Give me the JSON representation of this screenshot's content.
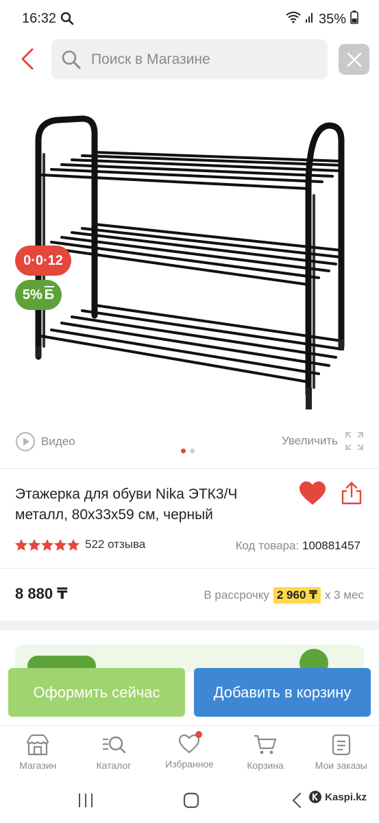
{
  "status": {
    "time": "16:32",
    "battery": "35%"
  },
  "search": {
    "placeholder": "Поиск в Магазине"
  },
  "badges": {
    "installment": "0·0·12",
    "bonus": "5%",
    "bonus_letter": "Б"
  },
  "media": {
    "video_label": "Видео",
    "zoom_label": "Увеличить",
    "slides": 2,
    "active_slide": 1
  },
  "product": {
    "title_line1": "Этажерка для обуви Nika ЭТК3/Ч",
    "title_line2": "металл, 80х33х59 см, черный",
    "rating": 5,
    "reviews": "522 отзыва",
    "code_label": "Код товара:",
    "code_value": "100881457",
    "price": "8 880 ₸",
    "installment_label": "В рассрочку",
    "installment_amount": "2 960 ₸",
    "installment_term": "х 3 мес"
  },
  "actions": {
    "checkout": "Оформить сейчас",
    "add_to_cart": "Добавить в корзину"
  },
  "nav": {
    "items": [
      {
        "label": "Магазин",
        "icon": "shop-icon"
      },
      {
        "label": "Каталог",
        "icon": "catalog-search-icon"
      },
      {
        "label": "Избранное",
        "icon": "heart-icon"
      },
      {
        "label": "Корзина",
        "icon": "cart-icon"
      },
      {
        "label": "Мои заказы",
        "icon": "orders-icon"
      }
    ]
  },
  "watermark": "Kaspi.kz",
  "colors": {
    "accent_red": "#e4473c",
    "green": "#5da33a",
    "blue": "#3d87d4",
    "light_green": "#9fd46e",
    "yellow": "#ffd94d"
  }
}
